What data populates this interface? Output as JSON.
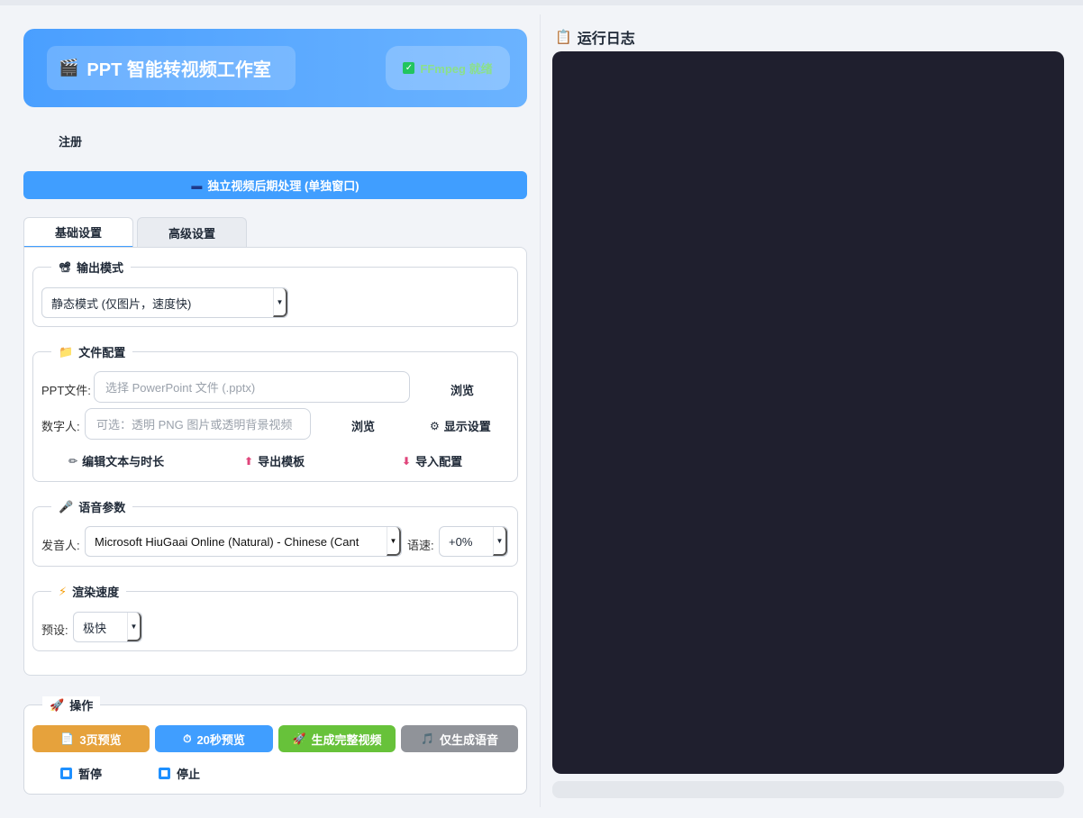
{
  "header": {
    "title": "PPT 智能转视频工作室",
    "title_icon": "clapper-icon",
    "ffmpeg_status": "FFmpeg 就绪"
  },
  "register_label": "注册",
  "post_processing_button": "独立视频后期处理 (单独窗口)",
  "tabs": [
    {
      "label": "基础设置",
      "active": true
    },
    {
      "label": "高级设置",
      "active": false
    }
  ],
  "output_mode": {
    "legend": "输出模式",
    "selected": "静态模式 (仅图片，速度快)"
  },
  "file_config": {
    "legend": "文件配置",
    "ppt_label": "PPT文件:",
    "ppt_placeholder": "选择 PowerPoint 文件 (.pptx)",
    "browse1": "浏览",
    "avatar_label": "数字人:",
    "avatar_placeholder": "可选：透明 PNG 图片或透明背景视频",
    "browse2": "浏览",
    "display_settings": "显示设置",
    "edit_text": "编辑文本与时长",
    "export_template": "导出模板",
    "import_config": "导入配置"
  },
  "voice": {
    "legend": "语音参数",
    "speaker_label": "发音人:",
    "speaker_value": "Microsoft HiuGaai Online (Natural) - Chinese (Cant",
    "rate_label": "语速:",
    "rate_value": "+0%"
  },
  "render": {
    "legend": "渲染速度",
    "preset_label": "预设:",
    "preset_value": "极快"
  },
  "operations": {
    "legend": "操作",
    "preview3": "3页预览",
    "preview20": "20秒预览",
    "generate": "生成完整视频",
    "voice_only": "仅生成语音",
    "pause": "暂停",
    "stop": "停止"
  },
  "log": {
    "title": "运行日志"
  },
  "colors": {
    "accent": "#409eff",
    "orange": "#e6a23c",
    "green": "#67c23a",
    "gray": "#909399",
    "log_bg": "#1f1f2e"
  }
}
